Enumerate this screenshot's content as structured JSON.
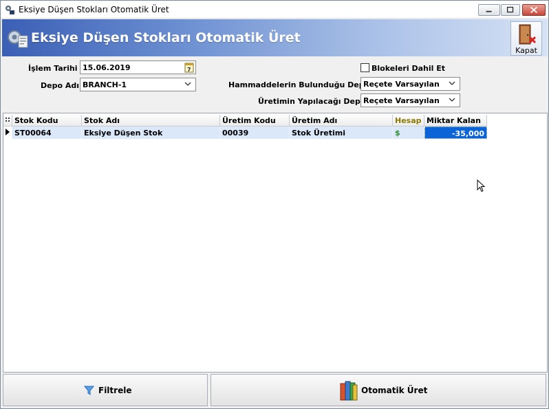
{
  "window": {
    "title": "Eksiye Düşen Stokları Otomatik Üret"
  },
  "header": {
    "title": "Eksiye Düşen Stokları Otomatik Üret",
    "close_label": "Kapat"
  },
  "form": {
    "islem_tarihi_label": "İşlem Tarihi",
    "islem_tarihi_value": "15.06.2019",
    "depo_adi_label": "Depo Adı",
    "depo_adi_value": "BRANCH-1",
    "blokeleri_label": "Blokeleri Dahil Et",
    "hammadde_label": "Hammaddelerin Bulunduğu Depo",
    "hammadde_value": "Reçete Varsayılan",
    "uretim_depo_label": "Üretimin Yapılacağı Depo",
    "uretim_depo_value": "Reçete Varsayılan"
  },
  "grid": {
    "columns": [
      "Stok Kodu",
      "Stok Adı",
      "Üretim Kodu",
      "Üretim Adı",
      "Hesap",
      "Miktar Kalan"
    ],
    "rows": [
      {
        "stok_kodu": "ST00064",
        "stok_adi": "Eksiye Düşen Stok",
        "uretim_kodu": "00039",
        "uretim_adi": "Stok Üretimi",
        "hesap": "$",
        "miktar_kalan": "-35,000"
      }
    ]
  },
  "buttons": {
    "filter_label": "Filtrele",
    "auto_label": "Otomatik Üret"
  },
  "colors": {
    "accent": "#3a5fb5",
    "selected_cell": "#0a64d8",
    "row_highlight": "#dbe8fa",
    "hesap_header": "#8c7a00"
  }
}
